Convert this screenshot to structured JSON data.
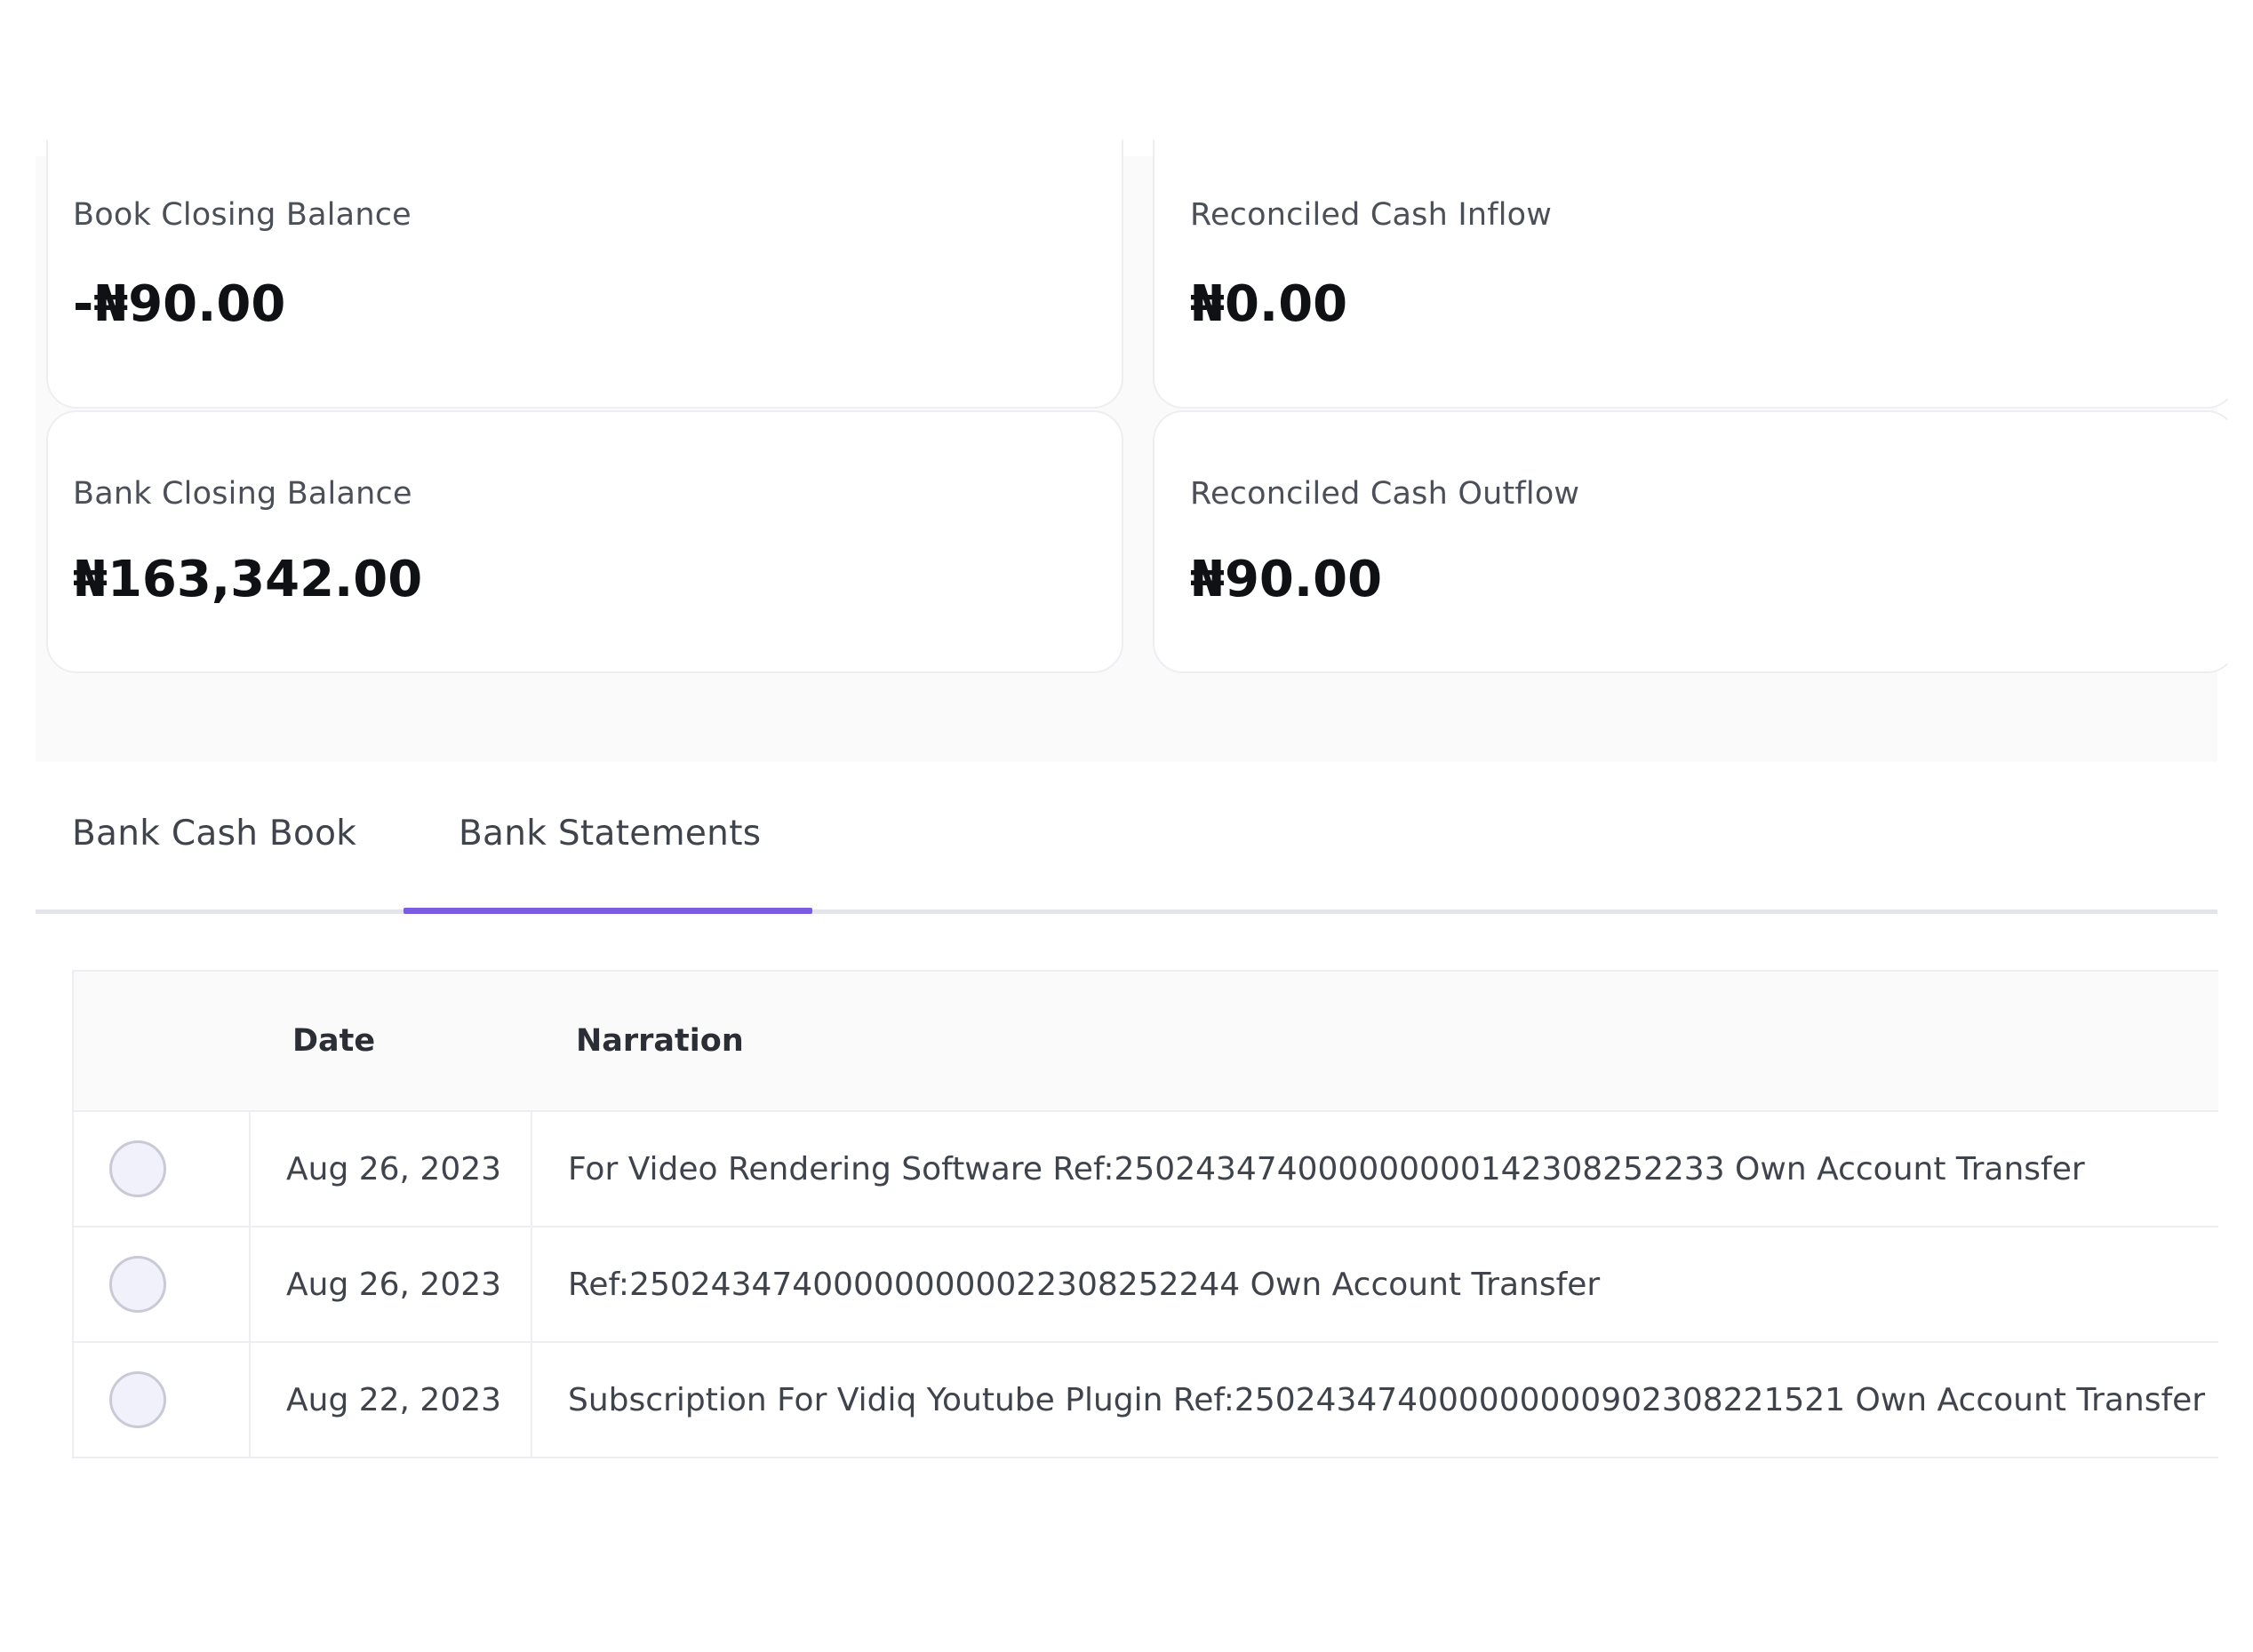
{
  "summary": {
    "book_closing_balance": {
      "label": "Book Closing Balance",
      "value": "-₦90.00"
    },
    "reconciled_cash_inflow": {
      "label": "Reconciled Cash Inflow",
      "value": "₦0.00"
    },
    "bank_closing_balance": {
      "label": "Bank Closing Balance",
      "value": "₦163,342.00"
    },
    "reconciled_cash_outflow": {
      "label": "Reconciled Cash Outflow",
      "value": "₦90.00"
    }
  },
  "tabs": [
    {
      "label": "Bank Cash Book",
      "active": false
    },
    {
      "label": "Bank Statements",
      "active": true
    }
  ],
  "accent_color": "#7b5ce0",
  "table": {
    "headers": {
      "select": "",
      "date": "Date",
      "narration": "Narration"
    },
    "rows": [
      {
        "selected": false,
        "date": "Aug 26, 2023",
        "narration": "For Video Rendering Software Ref:250243474000000000142308252233 Own Account Transfer"
      },
      {
        "selected": false,
        "date": "Aug 26, 2023",
        "narration": "Ref:250243474000000000022308252244 Own Account Transfer"
      },
      {
        "selected": false,
        "date": "Aug 22, 2023",
        "narration": "Subscription For Vidiq Youtube Plugin Ref:250243474000000000902308221521 Own Account Transfer"
      }
    ]
  }
}
